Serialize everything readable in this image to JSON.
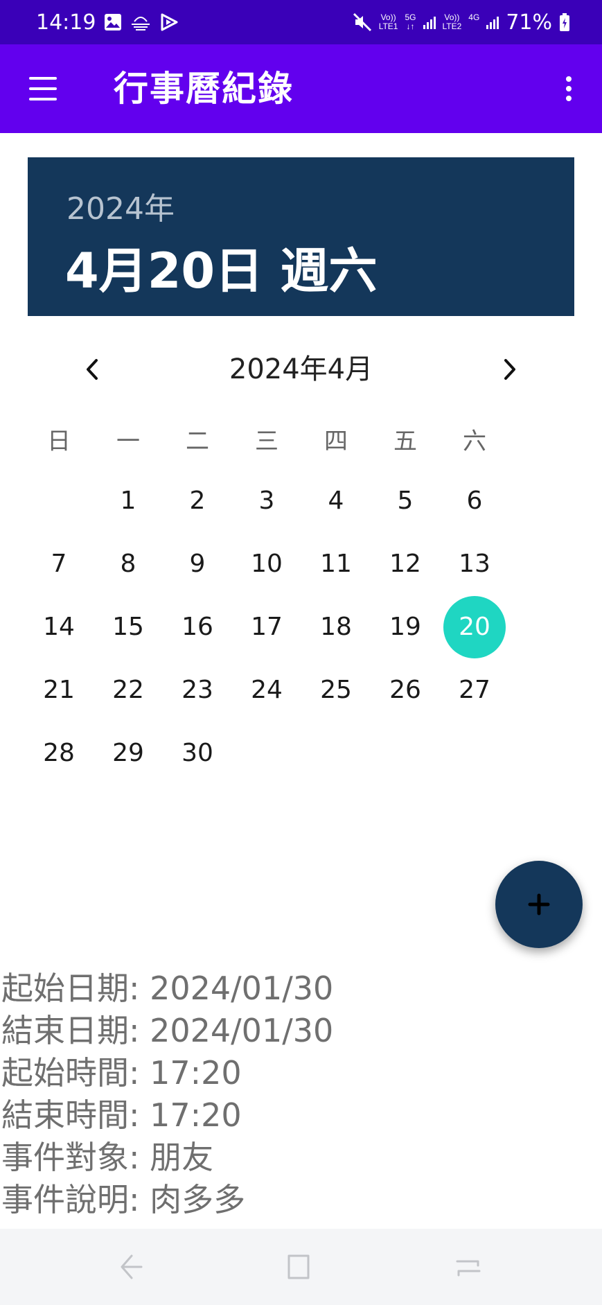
{
  "status_bar": {
    "time": "14:19",
    "icons": [
      "gallery-icon",
      "weather-icon",
      "play-store-icon",
      "mute-icon"
    ],
    "sim1_label_top": "Vo))",
    "sim1_label_bottom": "LTE1",
    "sim1_network": "5G",
    "sim2_label_top": "Vo))",
    "sim2_label_bottom": "LTE2",
    "sim2_network": "4G",
    "battery": "71%"
  },
  "app_bar": {
    "title": "行事曆紀錄",
    "menu_icon": "hamburger-menu-icon",
    "overflow_icon": "more-vert-icon",
    "color": "#6200ee"
  },
  "date_header": {
    "year": "2024年",
    "date": "4月20日 週六",
    "color": "#14375a"
  },
  "calendar": {
    "month_title": "2024年4月",
    "weekdays": [
      "日",
      "一",
      "二",
      "三",
      "四",
      "五",
      "六"
    ],
    "leading_blank_days": 1,
    "days": [
      "1",
      "2",
      "3",
      "4",
      "5",
      "6",
      "7",
      "8",
      "9",
      "10",
      "11",
      "12",
      "13",
      "14",
      "15",
      "16",
      "17",
      "18",
      "19",
      "20",
      "21",
      "22",
      "23",
      "24",
      "25",
      "26",
      "27",
      "28",
      "29",
      "30"
    ],
    "selected_day": "20",
    "selected_color": "#1fd6c2"
  },
  "fab": {
    "icon": "plus-icon"
  },
  "event_details": [
    "起始日期: 2024/01/30",
    "結束日期: 2024/01/30",
    "起始時間: 17:20",
    "結束時間: 17:20",
    "事件對象: 朋友",
    "事件說明: 肉多多"
  ],
  "nav_bar": {
    "icons": [
      "back-icon",
      "home-icon",
      "recents-icon"
    ]
  }
}
